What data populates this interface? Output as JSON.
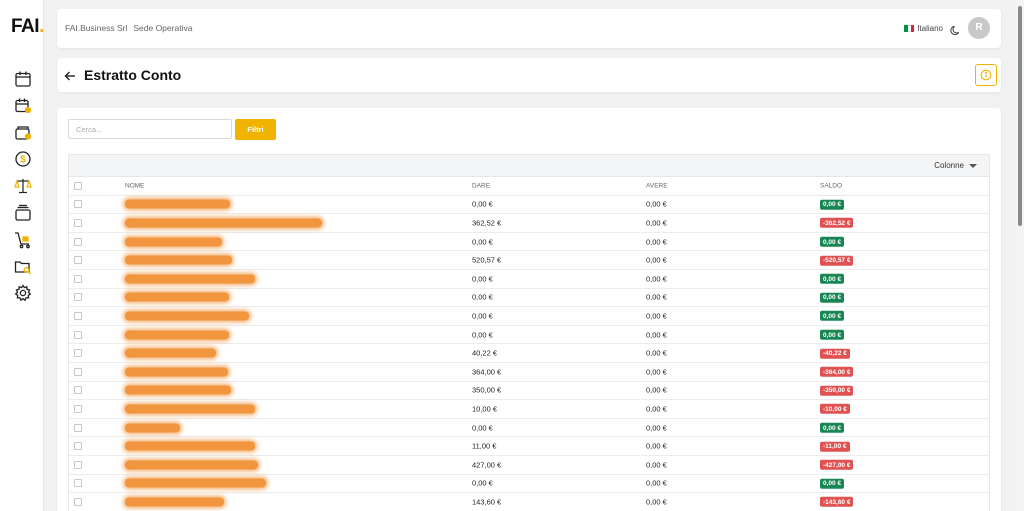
{
  "brand": {
    "logo_text": "FAI",
    "logo_dot": ".",
    "accent": "#f0b400"
  },
  "sidebar": {
    "items": [
      {
        "name": "calendar-icon"
      },
      {
        "name": "calendar-user-icon"
      },
      {
        "name": "wallet-icon"
      },
      {
        "name": "dollar-circle-icon"
      },
      {
        "name": "scale-icon"
      },
      {
        "name": "layers-icon"
      },
      {
        "name": "cart-icon"
      },
      {
        "name": "folder-search-icon"
      },
      {
        "name": "gear-icon"
      }
    ]
  },
  "header": {
    "company": "FAI.Business Srl",
    "location": "Sede Operativa",
    "language": "Italiano",
    "avatar_initial": "R"
  },
  "page": {
    "title": "Estratto Conto"
  },
  "toolbar": {
    "search_placeholder": "Cerca...",
    "filter_label": "Filtri"
  },
  "table": {
    "columns_button": "Colonne",
    "headers": {
      "name": "NOME",
      "dare": "DARE",
      "avere": "AVERE",
      "saldo": "SALDO"
    },
    "rows": [
      {
        "dare": "0,00 €",
        "avere": "0,00 €",
        "saldo": "0,00 €",
        "status": "pos",
        "name_blur": 105
      },
      {
        "dare": "362,52 €",
        "avere": "0,00 €",
        "saldo": "-362,52 €",
        "status": "neg",
        "name_blur": 197
      },
      {
        "dare": "0,00 €",
        "avere": "0,00 €",
        "saldo": "0,00 €",
        "status": "pos",
        "name_blur": 97
      },
      {
        "dare": "520,57 €",
        "avere": "0,00 €",
        "saldo": "-520,57 €",
        "status": "neg",
        "name_blur": 107
      },
      {
        "dare": "0,00 €",
        "avere": "0,00 €",
        "saldo": "0,00 €",
        "status": "pos",
        "name_blur": 130
      },
      {
        "dare": "0,00 €",
        "avere": "0,00 €",
        "saldo": "0,00 €",
        "status": "pos",
        "name_blur": 104
      },
      {
        "dare": "0,00 €",
        "avere": "0,00 €",
        "saldo": "0,00 €",
        "status": "pos",
        "name_blur": 124
      },
      {
        "dare": "0,00 €",
        "avere": "0,00 €",
        "saldo": "0,00 €",
        "status": "pos",
        "name_blur": 104
      },
      {
        "dare": "40,22 €",
        "avere": "0,00 €",
        "saldo": "-40,22 €",
        "status": "neg",
        "name_blur": 91
      },
      {
        "dare": "364,00 €",
        "avere": "0,00 €",
        "saldo": "-364,00 €",
        "status": "neg",
        "name_blur": 103
      },
      {
        "dare": "350,00 €",
        "avere": "0,00 €",
        "saldo": "-350,00 €",
        "status": "neg",
        "name_blur": 106
      },
      {
        "dare": "10,00 €",
        "avere": "0,00 €",
        "saldo": "-10,00 €",
        "status": "neg",
        "name_blur": 130
      },
      {
        "dare": "0,00 €",
        "avere": "0,00 €",
        "saldo": "0,00 €",
        "status": "pos",
        "name_blur": 55
      },
      {
        "dare": "11,00 €",
        "avere": "0,00 €",
        "saldo": "-11,00 €",
        "status": "neg",
        "name_blur": 130
      },
      {
        "dare": "427,00 €",
        "avere": "0,00 €",
        "saldo": "-427,00 €",
        "status": "neg",
        "name_blur": 133
      },
      {
        "dare": "0,00 €",
        "avere": "0,00 €",
        "saldo": "0,00 €",
        "status": "pos",
        "name_blur": 141
      },
      {
        "dare": "143,60 €",
        "avere": "0,00 €",
        "saldo": "-143,60 €",
        "status": "neg",
        "name_blur": 99
      }
    ]
  }
}
